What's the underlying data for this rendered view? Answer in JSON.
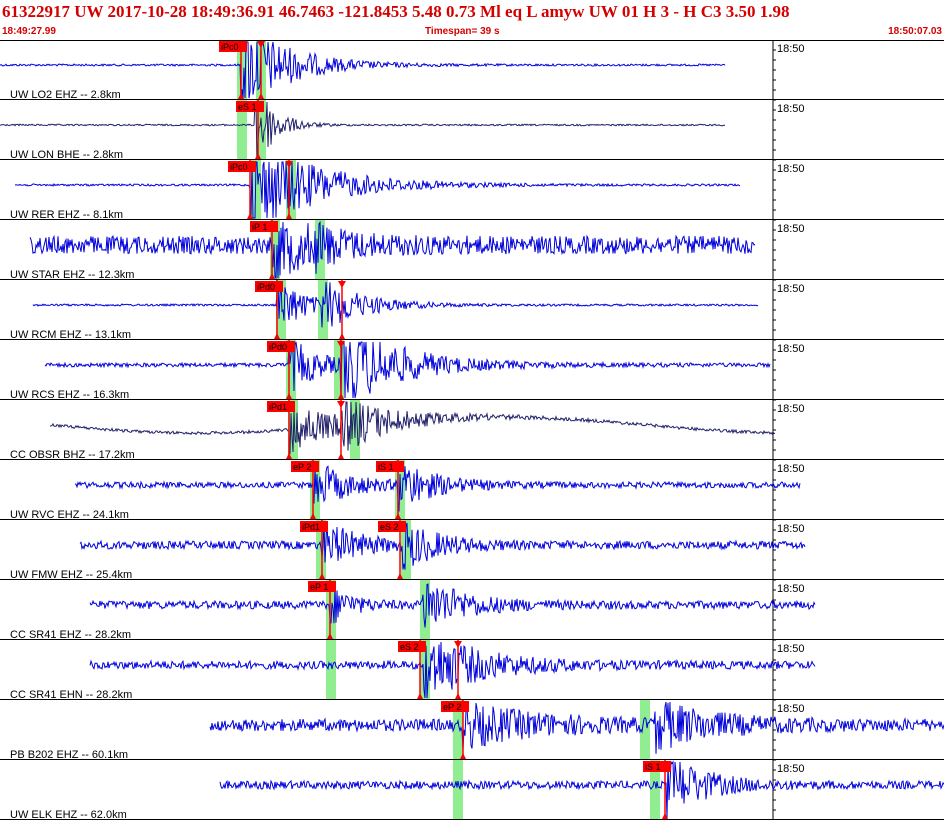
{
  "header": {
    "title": "61322917 UW 2017-10-28 18:49:36.91   46.7463 -121.8453   5.48  0.73 Ml  eq  L amyw    UW 01  H  3  -  H C3    3.50  1.98",
    "start_time": "18:49:27.99",
    "timespan": "Timespan=  39 s",
    "end_time": "18:50:07.03"
  },
  "colors": {
    "waveform": "#0000dd",
    "broadband_waveform": "#20206a",
    "pick": "#ff0000",
    "pick_window": "#90ee90",
    "grid": "#000000",
    "header_text": "#d40000"
  },
  "chart_data": {
    "type": "line",
    "title": "",
    "x_axis_tick_label": "18:50",
    "traces": [
      {
        "label": "UW LO2 EHZ -- 2.8km",
        "picks": [
          {
            "label": "iPc0",
            "t": 241
          },
          {
            "label": "",
            "t": 261
          }
        ],
        "green": [
          237,
          256
        ],
        "noise": 1,
        "burst": [
          [
            241,
            18,
            2.4
          ]
        ],
        "start": 0,
        "end": 725,
        "color": "#0000dd"
      },
      {
        "label": "UW LON BHE -- 2.8km",
        "picks": [
          {
            "label": "eS 1",
            "t": 258
          }
        ],
        "green": [
          237,
          256
        ],
        "noise": 0.8,
        "burst": [
          [
            255,
            7,
            2.4
          ]
        ],
        "start": 0,
        "end": 725,
        "color": "#20206a"
      },
      {
        "label": "UW RER EHZ -- 8.1km",
        "picks": [
          {
            "label": "iPc0",
            "t": 250
          },
          {
            "label": "",
            "t": 289
          }
        ],
        "green": [
          251,
          286
        ],
        "noise": 1,
        "burst": [
          [
            250,
            26,
            2.4
          ]
        ],
        "start": 15,
        "end": 740,
        "color": "#0000dd"
      },
      {
        "label": "UW STAR EHZ -- 12.3km",
        "picks": [
          {
            "label": "iP 1",
            "t": 272
          }
        ],
        "green": [
          270,
          315
        ],
        "noise": 9,
        "burst": [
          [
            272,
            20,
            1.3
          ],
          [
            315,
            12,
            1.0
          ]
        ],
        "start": 30,
        "end": 755,
        "color": "#0000dd"
      },
      {
        "label": "UW RCM EHZ -- 13.1km",
        "picks": [
          {
            "label": "iPd0",
            "t": 277
          },
          {
            "label": "",
            "t": 342
          }
        ],
        "green": [
          276,
          318
        ],
        "noise": 1,
        "burst": [
          [
            277,
            10,
            1.5
          ],
          [
            322,
            16,
            1.3
          ]
        ],
        "start": 33,
        "end": 758,
        "color": "#0000dd"
      },
      {
        "label": "UW RCS EHZ -- 16.3km",
        "picks": [
          {
            "label": "iPd0",
            "t": 289
          },
          {
            "label": "",
            "t": 341
          }
        ],
        "green": [
          286,
          334
        ],
        "noise": 2,
        "burst": [
          [
            289,
            12,
            1.3
          ],
          [
            341,
            22,
            2.3
          ]
        ],
        "start": 45,
        "end": 770,
        "color": "#0000dd"
      },
      {
        "label": "CC OBSR BHZ -- 17.2km",
        "picks": [
          {
            "label": "iPd1",
            "t": 289
          },
          {
            "label": "",
            "t": 341
          }
        ],
        "green": [
          288,
          350
        ],
        "noise": 1.5,
        "burst": [
          [
            290,
            20,
            1.2
          ],
          [
            341,
            20,
            1.4
          ]
        ],
        "start": 50,
        "end": 775,
        "color": "#20206a"
      },
      {
        "label": "UW RVC EHZ -- 24.1km",
        "picks": [
          {
            "label": "eP 2",
            "t": 313
          },
          {
            "label": "iS 1",
            "t": 398
          }
        ],
        "green": [
          310,
          395
        ],
        "noise": 3,
        "burst": [
          [
            313,
            14,
            1.1
          ],
          [
            398,
            14,
            1.2
          ]
        ],
        "start": 75,
        "end": 800,
        "color": "#0000dd"
      },
      {
        "label": "UW FMW EHZ -- 25.4km",
        "picks": [
          {
            "label": "iPd1",
            "t": 322
          },
          {
            "label": "eS 2",
            "t": 400
          }
        ],
        "green": [
          316,
          401
        ],
        "noise": 4,
        "burst": [
          [
            322,
            14,
            1.1
          ],
          [
            403,
            14,
            1.1
          ]
        ],
        "start": 80,
        "end": 805,
        "color": "#0000dd"
      },
      {
        "label": "CC SR41 EHZ -- 28.2km",
        "picks": [
          {
            "label": "eP 1",
            "t": 330
          }
        ],
        "green": [
          326,
          420
        ],
        "noise": 4,
        "burst": [
          [
            330,
            8,
            0.9
          ],
          [
            422,
            16,
            1.3
          ]
        ],
        "start": 90,
        "end": 815,
        "color": "#0000dd"
      },
      {
        "label": "CC SR41 EHN -- 28.2km",
        "picks": [
          {
            "label": "eS 2",
            "t": 420
          },
          {
            "label": "",
            "t": 458
          }
        ],
        "green": [
          326,
          420
        ],
        "noise": 4,
        "burst": [
          [
            424,
            22,
            1.6
          ]
        ],
        "start": 90,
        "end": 815,
        "color": "#0000dd"
      },
      {
        "label": "PB B202 EHZ -- 60.1km",
        "picks": [
          {
            "label": "eP 2",
            "t": 463
          }
        ],
        "green": [
          453,
          640
        ],
        "noise": 6,
        "burst": [
          [
            463,
            30,
            0.9
          ],
          [
            655,
            22,
            1.1
          ]
        ],
        "start": 210,
        "end": 944,
        "color": "#0000dd"
      },
      {
        "label": "UW ELK EHZ -- 62.0km",
        "picks": [
          {
            "label": "iS 1",
            "t": 665
          }
        ],
        "green": [
          453,
          650
        ],
        "noise": 4,
        "burst": [
          [
            665,
            14,
            1.6
          ]
        ],
        "start": 220,
        "end": 944,
        "color": "#0000dd"
      }
    ]
  }
}
